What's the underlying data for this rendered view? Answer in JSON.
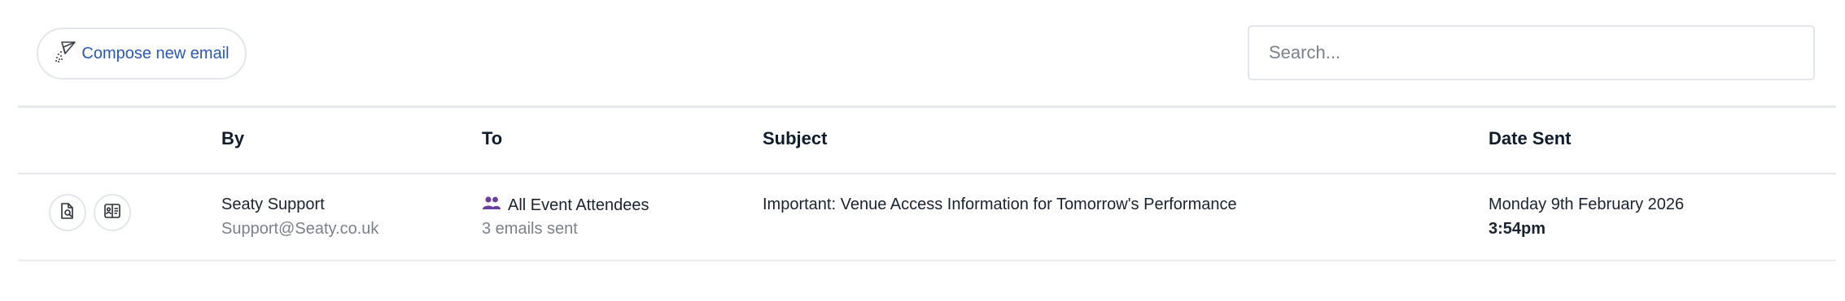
{
  "toolbar": {
    "compose_label": "Compose new email",
    "search_placeholder": "Search...",
    "search_value": ""
  },
  "table": {
    "columns": [
      "By",
      "To",
      "Subject",
      "Date Sent"
    ],
    "rows": [
      {
        "by_name": "Seaty Support",
        "by_email": "Support@Seaty.co.uk",
        "to_group": "All Event Attendees",
        "to_count": "3 emails sent",
        "subject": "Important: Venue Access Information for Tomorrow's Performance",
        "date": "Monday 9th February 2026",
        "time": "3:54pm"
      }
    ]
  },
  "icons": {
    "compose": "paper-plane-icon",
    "preview": "document-search-icon",
    "recipients": "address-card-icon",
    "group": "users-icon"
  },
  "colors": {
    "accent": "#2a57b8",
    "group_icon": "#6b3fa0",
    "text": "#1a2330",
    "muted": "#7a828c",
    "border": "#e3e6ea"
  }
}
